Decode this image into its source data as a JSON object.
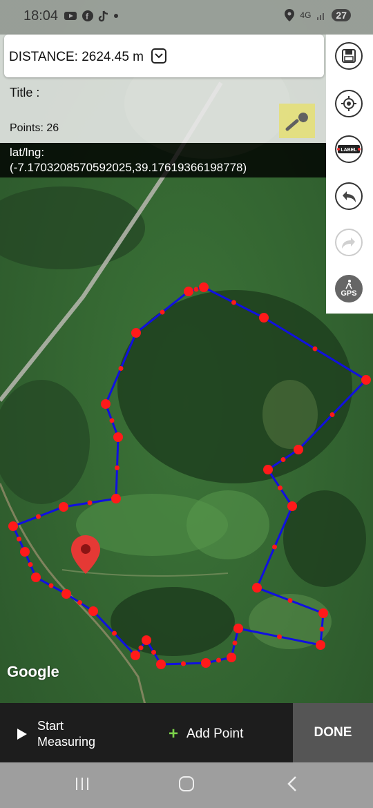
{
  "status": {
    "time": "18:04",
    "network": "4G",
    "battery": "27"
  },
  "info": {
    "distance": "DISTANCE: 2624.45 m",
    "title": "Title :",
    "points": "Points: 26",
    "latlng_label": "lat/lng:",
    "latlng_value": "(-7.1703208570592025,39.17619366198778)"
  },
  "toolbar": {
    "label_icon_text": "LABEL",
    "gps_text": "GPS"
  },
  "map": {
    "attribution": "Google"
  },
  "bottom": {
    "start_line1": "Start",
    "start_line2": "Measuring",
    "add_point": "Add Point",
    "done": "DONE"
  },
  "colors": {
    "route": "#1010e0",
    "point": "#ff1a1a",
    "accent_green": "#7bd14a"
  }
}
